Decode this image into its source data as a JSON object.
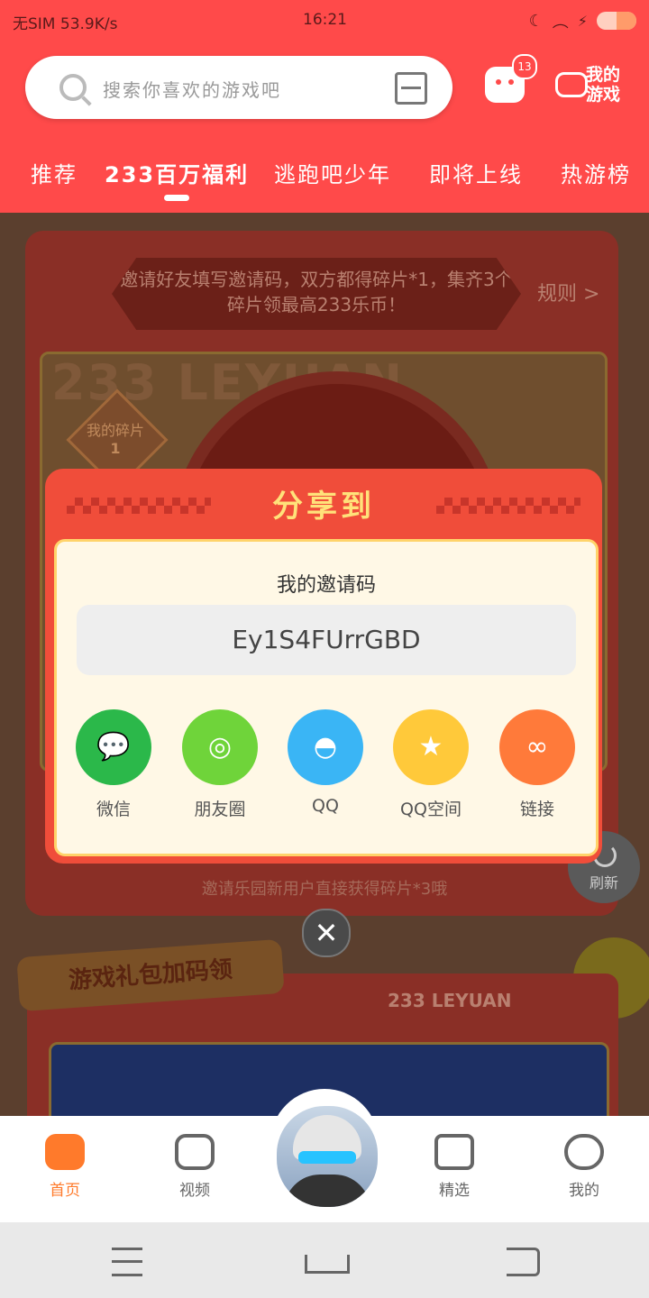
{
  "status_bar": {
    "left": "无SIM 53.9K/s",
    "time": "16:21"
  },
  "search": {
    "placeholder": "搜索你喜欢的游戏吧"
  },
  "header": {
    "message_badge": "13",
    "my_games_label": "我的\n游戏"
  },
  "tabs": [
    {
      "label": "推荐"
    },
    {
      "label": "233百万福利"
    },
    {
      "label": "逃跑吧少年"
    },
    {
      "label": "即将上线"
    },
    {
      "label": "热游榜"
    }
  ],
  "background_page": {
    "banner_text": "邀请好友填写邀请码，双方都得碎片*1，集齐3个碎片领最高233乐币！",
    "rules_link": "规则 >",
    "my_fragments_label": "我的碎片",
    "my_fragments_count": "1",
    "watermark": "233 LEYUAN",
    "invite_hint": "邀请乐园新用户直接获得碎片*3哦",
    "refresh_label": "刷新",
    "gift_section_title": "游戏礼包加码领",
    "gift_brand": "233 LEYUAN"
  },
  "share_modal": {
    "title": "分享到",
    "code_label": "我的邀请码",
    "invite_code": "Ey1S4FUrrGBD",
    "options": [
      {
        "label": "微信",
        "color": "#2bb84a",
        "icon": "wechat-icon"
      },
      {
        "label": "朋友圈",
        "color": "#6fd43a",
        "icon": "moments-icon"
      },
      {
        "label": "QQ",
        "color": "#3ab5f5",
        "icon": "qq-icon"
      },
      {
        "label": "QQ空间",
        "color": "#ffc93a",
        "icon": "qzone-icon"
      },
      {
        "label": "链接",
        "color": "#ff7a3a",
        "icon": "link-icon"
      }
    ]
  },
  "bottom_nav": [
    {
      "label": "首页",
      "icon": "gamepad-icon",
      "active": true
    },
    {
      "label": "视频",
      "icon": "video-icon",
      "active": false
    },
    {
      "label": "精选",
      "icon": "heart-icon",
      "active": false
    },
    {
      "label": "我的",
      "icon": "face-icon",
      "active": false
    }
  ],
  "colors": {
    "header": "#ff4a4a",
    "accent": "#ff7a2b",
    "modal": "#f04d3a"
  }
}
